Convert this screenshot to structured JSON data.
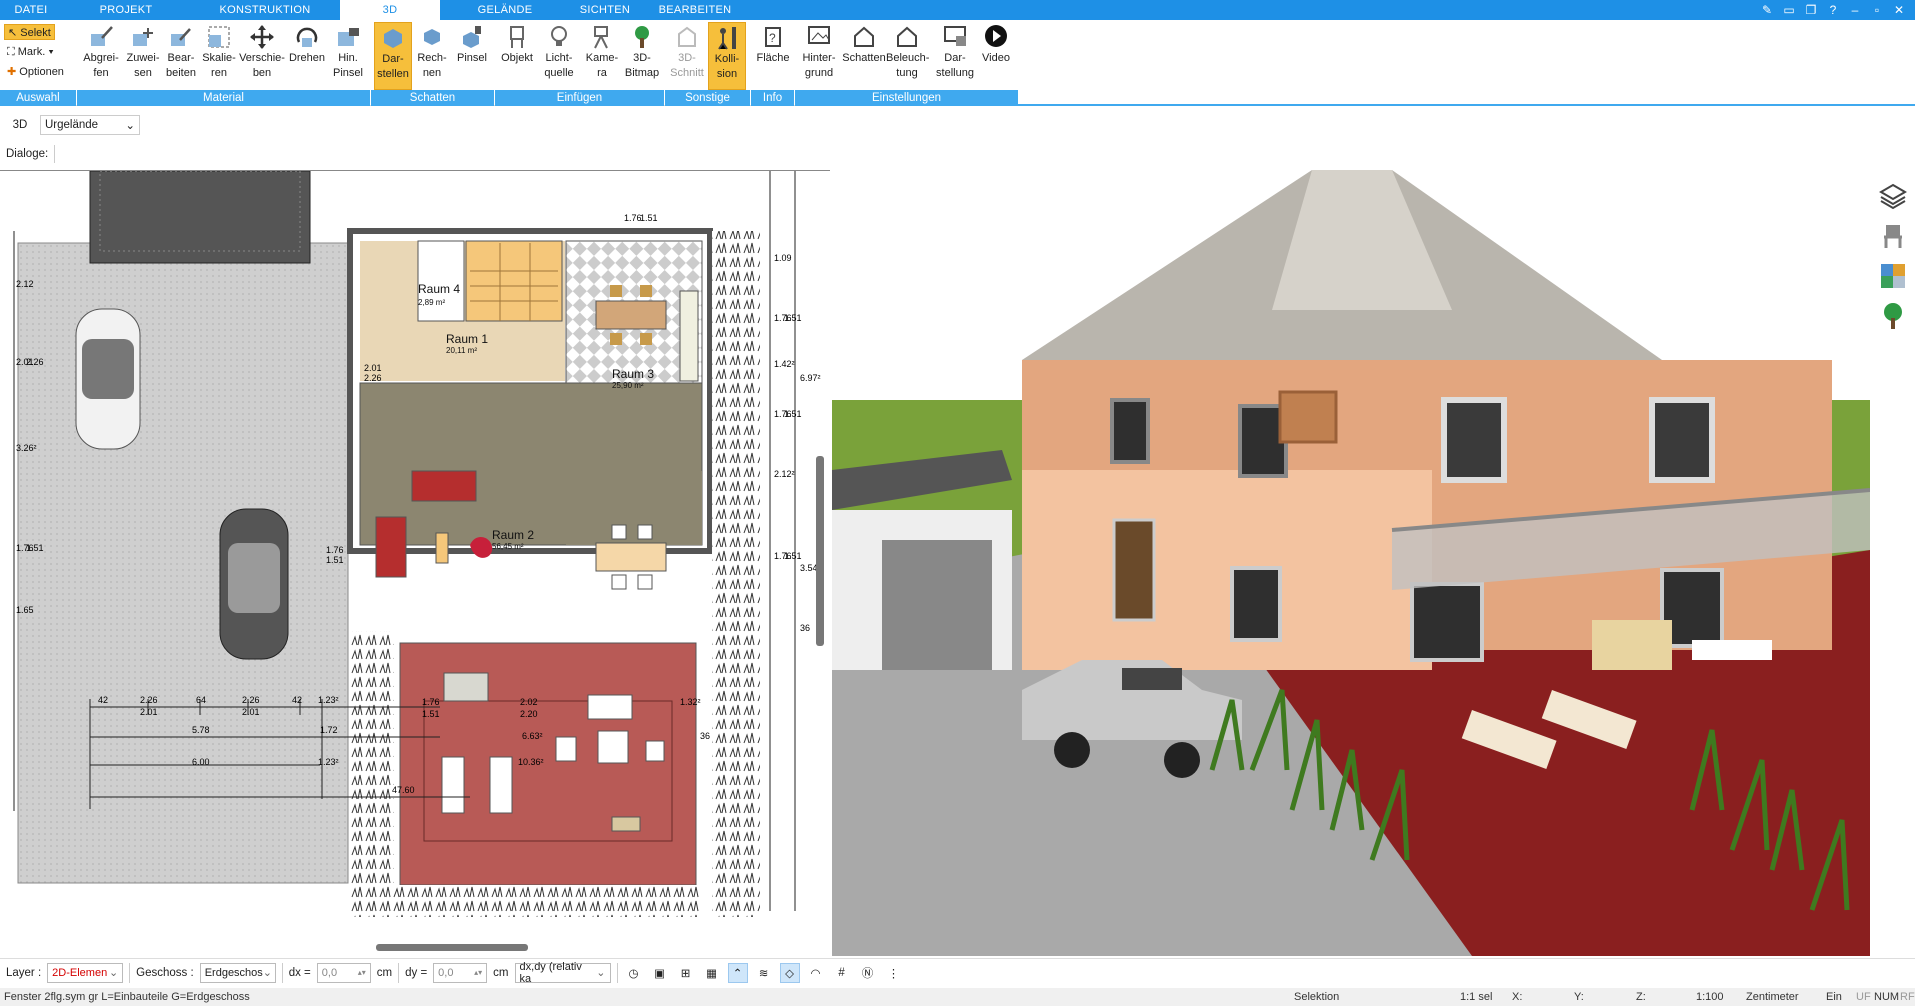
{
  "menu": {
    "tabs": [
      "DATEI",
      "PROJEKT",
      "KONSTRUKTION",
      "3D",
      "GELÄNDE",
      "SICHTEN",
      "BEARBEITEN"
    ],
    "active": "3D"
  },
  "ribbon": {
    "selection": {
      "select": "Selekt",
      "mark": "Mark.",
      "options": "Optionen"
    },
    "buttons": {
      "abgreifen": "Abgrei-\nfen",
      "zuweisen": "Zuwei-\nsen",
      "bearbeiten": "Bear-\nbeiten",
      "skalieren": "Skalie-\nren",
      "verschieben": "Verschie-\nben",
      "drehen": "Drehen",
      "hin_pinsel": "Hin.\nPinsel",
      "darstellen": "Dar-\nstellen",
      "rechnen": "Rech-\nnen",
      "pinsel": "Pinsel",
      "objekt": "Objekt",
      "lichtquelle": "Licht-\nquelle",
      "kamera": "Kame-\nra",
      "bitmap": "3D-\nBitmap",
      "schnitt": "3D-\nSchnitt",
      "kollision": "Kolli-\nsion",
      "flaeche": "Fläche",
      "hintergrund": "Hinter-\ngrund",
      "schatten": "Schatten",
      "beleuchtung": "Beleuch-\ntung",
      "darstellung": "Dar-\nstellung",
      "video": "Video"
    },
    "groups": {
      "auswahl": "Auswahl",
      "material": "Material",
      "schatten": "Schatten",
      "einfuegen": "Einfügen",
      "sonstige": "Sonstige",
      "info": "Info",
      "einstellungen": "Einstellungen"
    },
    "accent": "#3fa9ef",
    "active_color": "#f6bf3b"
  },
  "toolbar3d": {
    "label": "3D",
    "terrain": "Urgelände"
  },
  "dialoge": {
    "label": "Dialoge:"
  },
  "plan": {
    "rooms": [
      {
        "name": "Raum 4",
        "area": "2,89 m²"
      },
      {
        "name": "Raum 1",
        "area": "20,11 m²"
      },
      {
        "name": "Raum 3",
        "area": "25,90 m²"
      },
      {
        "name": "Raum 2",
        "area": "56,45 m²"
      }
    ],
    "dims_bottom_a": [
      "42",
      "2.26",
      "64",
      "2.26",
      "42",
      "1.23²"
    ],
    "dims_bottom_a2": [
      "2.01",
      "2.01"
    ],
    "dims_bottom_b": [
      "5.78",
      "1.72"
    ],
    "dims_bottom_c": [
      "6.00",
      "1.23²"
    ],
    "dim_47": "47.60",
    "terrace_dims": [
      "1.76",
      "2.02",
      "1.32²",
      "1.51",
      "2.20",
      "6.63²",
      "10.36²",
      "36"
    ],
    "right_dims": [
      "1.09",
      "1.76",
      "1.51",
      "1.42²",
      "1.76",
      "1.51",
      "2.12²",
      "1.76",
      "1.51",
      "3.54²",
      "6.97²",
      "36"
    ],
    "left_dims": [
      "2.12",
      "2.26",
      "2.01",
      "3.26²",
      "1.76",
      "1.51",
      "1.65"
    ],
    "top_dims": [
      "1.76",
      "1.51"
    ],
    "door_dims": [
      "2.01",
      "2.26",
      "1.76",
      "1.51"
    ]
  },
  "sidebar_icons": [
    "layers-icon",
    "furniture-icon",
    "materials-icon",
    "tree-icon"
  ],
  "bottombar": {
    "layer_label": "Layer :",
    "layer_value": "2D-Elemen",
    "geschoss_label": "Geschoss :",
    "geschoss_value": "Erdgeschos",
    "dx_label": "dx =",
    "dx_value": "0,0",
    "dx_unit": "cm",
    "dy_label": "dy =",
    "dy_value": "0,0",
    "dy_unit": "cm",
    "mode": "dx,dy (relativ ka"
  },
  "statusbar": {
    "left": "Fenster 2flg.sym gr L=Einbauteile G=Erdgeschoss",
    "mode": "Selektion",
    "sel": "1:1 sel",
    "x": "X:",
    "y": "Y:",
    "z": "Z:",
    "scale": "1:100",
    "unit": "Zentimeter",
    "ein": "Ein",
    "uf": "UF",
    "num": "NUM",
    "rf": "RF"
  }
}
